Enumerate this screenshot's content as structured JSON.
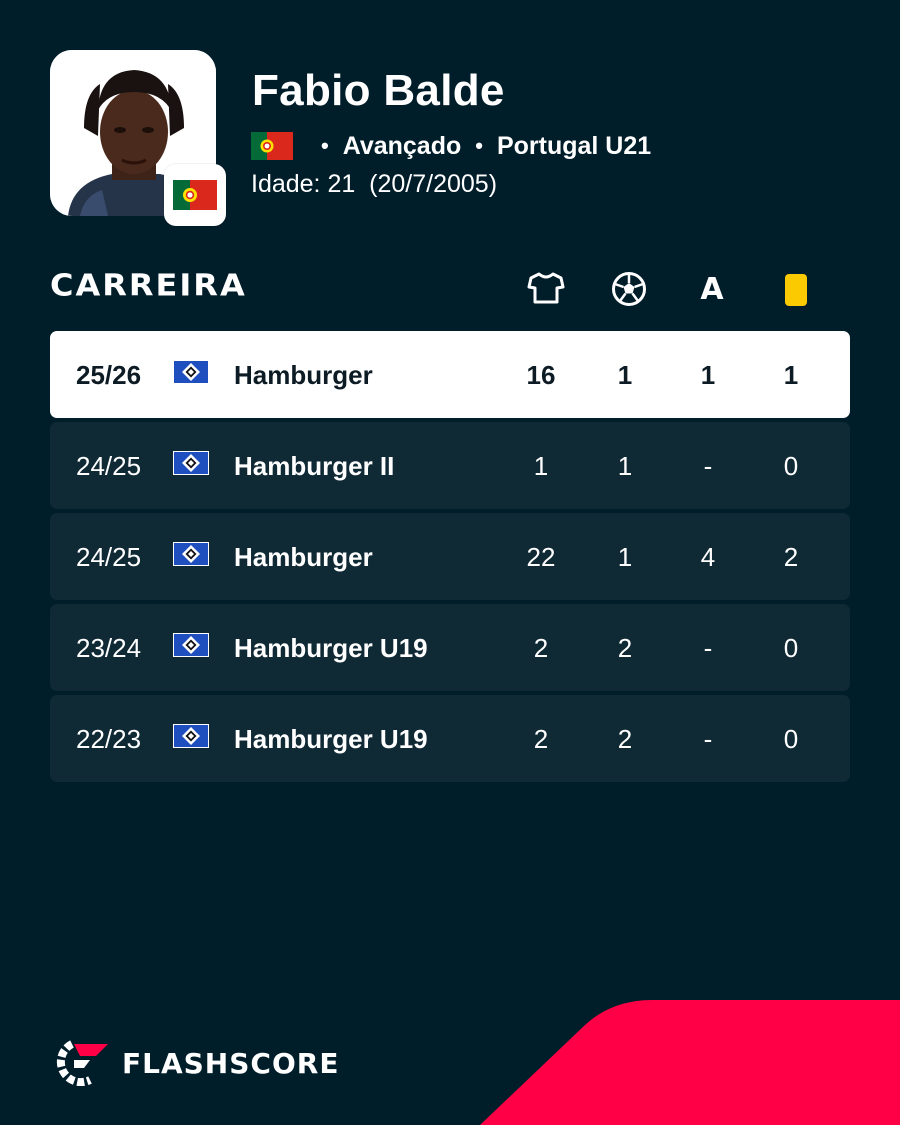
{
  "player": {
    "name": "Fabio Balde",
    "position": "Avançado",
    "team": "Portugal U21",
    "age_label": "Idade: 21",
    "birth_date": "(20/7/2005)"
  },
  "career": {
    "title": "CARREIRA",
    "columns": {
      "appearances_icon": "shirt-icon",
      "goals_icon": "football-icon",
      "assists_label": "A",
      "yellow_cards_icon": "yellow-card-icon"
    },
    "rows": [
      {
        "season": "25/26",
        "club": "Hamburger",
        "apps": "16",
        "goals": "1",
        "assists": "1",
        "cards": "1",
        "highlight": true
      },
      {
        "season": "24/25",
        "club": "Hamburger II",
        "apps": "1",
        "goals": "1",
        "assists": "-",
        "cards": "0",
        "highlight": false
      },
      {
        "season": "24/25",
        "club": "Hamburger",
        "apps": "22",
        "goals": "1",
        "assists": "4",
        "cards": "2",
        "highlight": false
      },
      {
        "season": "23/24",
        "club": "Hamburger U19",
        "apps": "2",
        "goals": "2",
        "assists": "-",
        "cards": "0",
        "highlight": false
      },
      {
        "season": "22/23",
        "club": "Hamburger U19",
        "apps": "2",
        "goals": "2",
        "assists": "-",
        "cards": "0",
        "highlight": false
      }
    ]
  },
  "brand": {
    "name": "FLASHSCORE"
  },
  "colors": {
    "background": "#001d2a",
    "row": "#0f2935",
    "accent": "#ff0046",
    "card_yellow": "#fcca00"
  }
}
